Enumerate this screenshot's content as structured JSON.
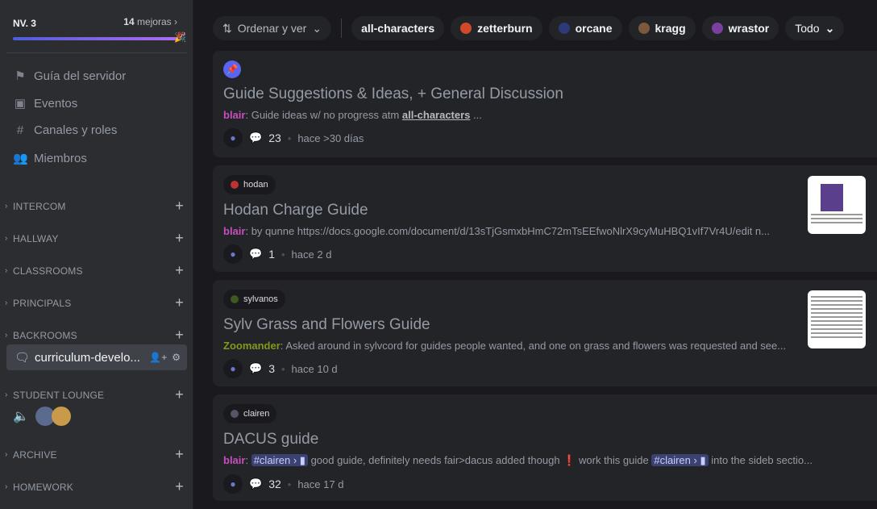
{
  "sidebar": {
    "boost": {
      "level": "NV. 3",
      "count": "14",
      "count_label": "mejoras",
      "progress": 1.0
    },
    "nav": [
      {
        "label": "Guía del servidor",
        "icon": "signpost-icon"
      },
      {
        "label": "Eventos",
        "icon": "calendar-icon"
      },
      {
        "label": "Canales y roles",
        "icon": "channels-roles-icon"
      },
      {
        "label": "Miembros",
        "icon": "members-icon"
      }
    ],
    "categories": [
      "INTERCOM",
      "HALLWAY",
      "CLASSROOMS",
      "PRINCIPALS",
      "BACKROOMS",
      "STUDENT LOUNGE",
      "ARCHIVE",
      "HOMEWORK"
    ],
    "active_channel": "curriculum-develo..."
  },
  "filters": {
    "sort_label": "Ordenar y ver",
    "tags": [
      "all-characters",
      "zetterburn",
      "orcane",
      "kragg",
      "wrastor"
    ],
    "more_label": "Todo"
  },
  "posts": [
    {
      "tag": "",
      "title": "Guide Suggestions & Ideas, + General Discussion",
      "author": "blair",
      "author_color": "#c64fbd",
      "text": "Guide ideas w/ no progress atm ",
      "link": "all-characters",
      "tail": " ...",
      "comments": "23",
      "time": "hace >30 días"
    },
    {
      "tag": "hodan",
      "title": "Hodan Charge Guide",
      "author": "blair",
      "author_color": "#c64fbd",
      "text": "by qunne https://docs.google.com/document/d/13sTjGsmxbHmC72mTsEEfwoNlrX9cyMuHBQ1vIf7Vr4U/edit n...",
      "comments": "1",
      "time": "hace 2 d"
    },
    {
      "tag": "sylvanos",
      "title": "Sylv Grass and Flowers Guide",
      "author": "Zoomander",
      "author_color": "#7f9a1c",
      "text": "Asked around in sylvcord for guides people wanted, and one on grass and flowers was requested and see...",
      "comments": "3",
      "time": "hace 10 d"
    },
    {
      "tag": "clairen",
      "title": "DACUS guide",
      "author": "blair",
      "author_color": "#c64fbd",
      "mention": "#clairen",
      "text": "good guide, definitely needs fair>dacus added though",
      "text2": "work this guide",
      "tail": "into the sideb sectio...",
      "comments": "32",
      "time": "hace 17 d"
    }
  ]
}
